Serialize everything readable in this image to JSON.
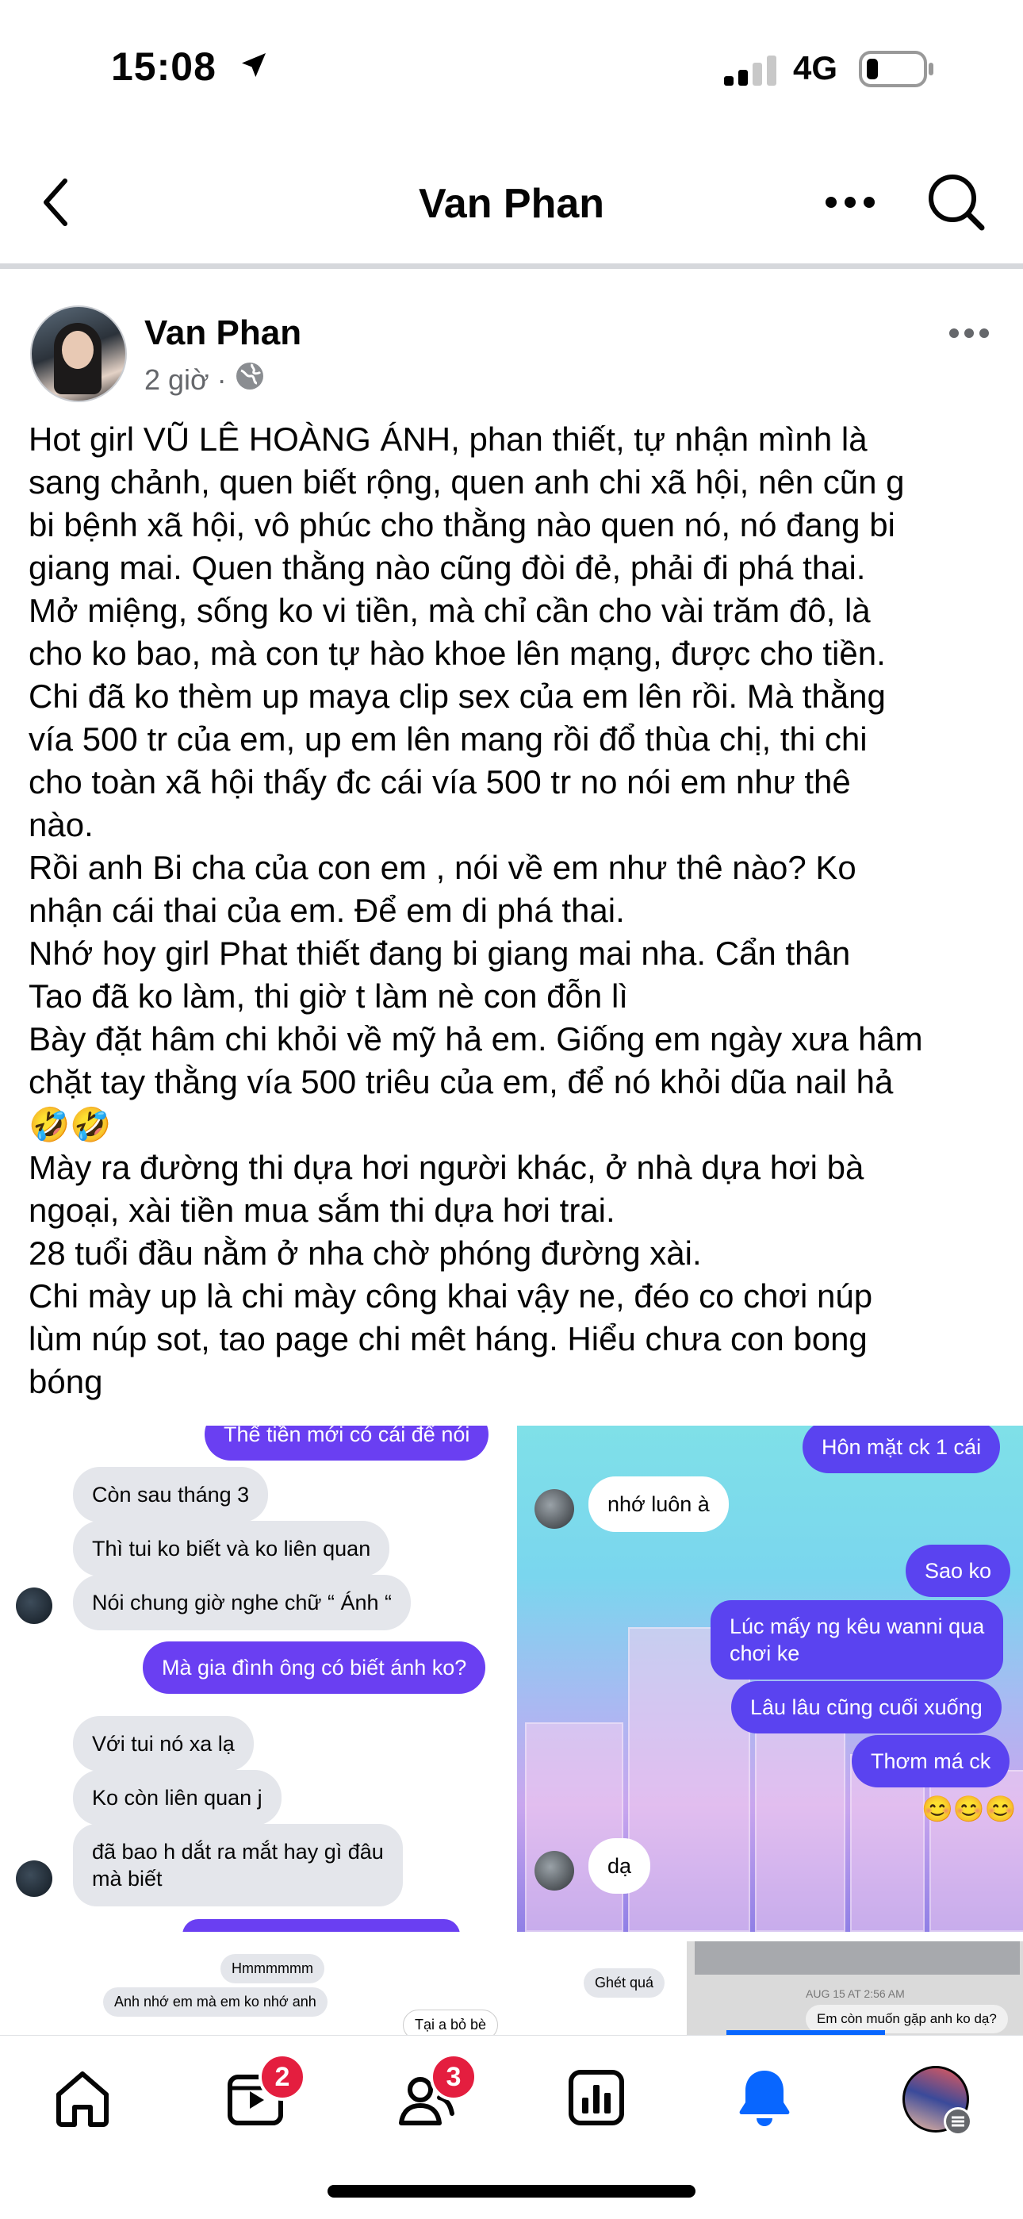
{
  "status_bar": {
    "time": "15:08",
    "network": "4G"
  },
  "nav": {
    "title": "Van Phan"
  },
  "post": {
    "author": "Van Phan",
    "time": "2 giờ",
    "separator": "·",
    "lines": [
      "Hot girl VŨ LÊ HOÀNG ÁNH, phan thiết, tự nhận mình là",
      "sang chảnh, quen biết rộng, quen anh chi xã hội, nên cũn g",
      "bi bệnh xã hội, vô phúc cho thằng nào quen nó, nó đang bi",
      "giang mai. Quen thằng nào cũng đòi đẻ, phải đi phá thai.",
      "Mở miệng, sống ko vi tiền, mà chỉ cần cho vài trăm đô, là",
      "cho ko bao, mà con tự hào khoe lên mạng, được cho tiền.",
      "Chi đã ko thèm up maya clip sex của em lên rồi. Mà thằng",
      "vía 500 tr của em, up em lên mang rồi đổ thùa chị, thi chi",
      "cho toàn xã hội thấy đc cái vía 500 tr no nói em như thê",
      "nào.",
      "Rồi anh Bi cha của con em , nói về em như thê nào? Ko",
      "nhận cái thai của em. Để em di phá thai.",
      "Nhớ hoy girl Phat thiết đang bi giang mai nha. Cẩn thân",
      "Tao đã ko làm, thi giờ t làm nè con đỗn lì",
      "Bày đặt hâm chi khỏi về mỹ hả em. Giống em ngày xưa hâm",
      "chặt tay thằng vía 500 triêu của em, để nó khỏi dũa nail hả",
      "🤣🤣",
      "Mày ra đường thi dựa hơi người khác, ở nhà dựa hơi bà",
      "ngoại, xài tiền mua sắm thi dựa hơi trai.",
      "28 tuổi đầu nằm ở nha chờ phóng đường xài.",
      "Chi mày up là chi mày công khai vậy ne, đéo co chơi núp",
      "lùm núp sot, tao page chi mêt háng. Hiểu chưa con bong",
      "bóng"
    ]
  },
  "screenshot1": {
    "top_cut": "Thế tiền mới có cái để nói",
    "in1": "Còn sau tháng 3",
    "in2": "Thì tui ko biết và ko liên quan",
    "in3": "Nói chung giờ nghe chữ “ Ánh “",
    "out1": "Mà gia đình ông có biết ánh ko?",
    "in4": "Với tui nó xa lạ",
    "in5": "Ko còn liên quan j",
    "in6a": "đã bao h dắt ra mắt hay gì đâu",
    "in6b": "mà biết"
  },
  "screenshot2": {
    "out_top": "Hôn mặt ck 1 cái",
    "in1": "nhớ luôn à",
    "out1": "Sao ko",
    "out2a": "Lúc mấy ng kêu wanni qua",
    "out2b": "chơi ke",
    "out3": "Lâu lâu cũng cuối xuống",
    "out4": "Thơm má ck",
    "emojis": "😊😊😊",
    "in2": "dạ"
  },
  "strip": {
    "s1a": "Hmmmmmm",
    "s1b": "Anh nhớ em mà em ko nhớ anh",
    "s2a": "Ghét quá",
    "s2b": "Tại a bỏ bè",
    "s3a": "AUG 15 AT 2:56 AM",
    "s3b": "Em còn muốn gặp anh ko dạ?"
  },
  "tabbar": {
    "video_badge": "2",
    "friends_badge": "3"
  },
  "colors": {
    "accent": "#0866ff",
    "badge": "#e41e3f",
    "messenger_purple": "#6a3ff2"
  }
}
